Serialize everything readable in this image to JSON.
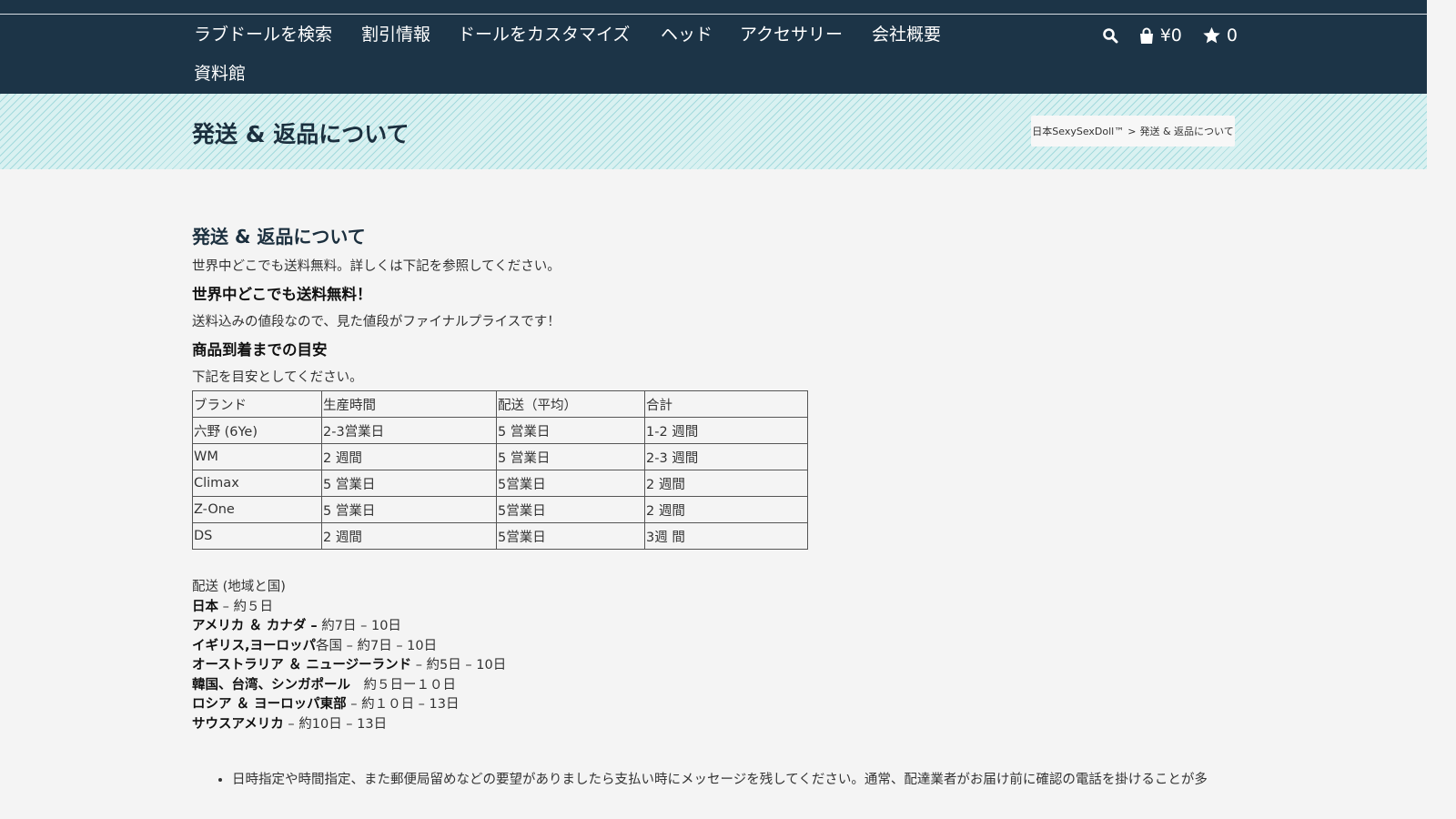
{
  "nav": {
    "items": [
      "ラブドールを検索",
      "割引情報",
      "ドールをカスタマイズ",
      "ヘッド",
      "アクセサリー",
      "会社概要",
      "資料館"
    ],
    "cart_amount": "¥0",
    "wishlist_count": "0",
    "icons": [
      "search-icon",
      "bag-icon",
      "star-icon"
    ]
  },
  "banner": {
    "title": "発送 & 返品について",
    "breadcrumb_home": "日本SexySexDoll™",
    "breadcrumb_sep": ">",
    "breadcrumb_current": "発送 & 返品について"
  },
  "content": {
    "heading": "発送 & 返品について",
    "intro": "世界中どこでも送料無料。詳しくは下記を参照してください。",
    "free_shipping_heading": "世界中どこでも送料無料！",
    "free_shipping_text": "送料込みの値段なので、見た値段がファイナルプライスです！",
    "arrival_heading": "商品到着までの目安",
    "arrival_text": "下記を目安としてください。",
    "table": {
      "headers": [
        "ブランド",
        "生産時間",
        "配送（平均）",
        "合計"
      ],
      "rows": [
        [
          "六野 (6Ye)",
          "2-3営業日",
          "5 営業日",
          "1-2 週間"
        ],
        [
          "WM",
          "2 週間",
          "5 営業日",
          "2-3 週間"
        ],
        [
          "Climax",
          "5 営業日",
          "5営業日",
          "2 週間"
        ],
        [
          "Z-One",
          "5 営業日",
          "5営業日",
          "2 週間"
        ],
        [
          "DS",
          "2 週間",
          "5営業日",
          "3週 間"
        ]
      ]
    },
    "regions_heading": "配送 (地域と国)",
    "regions": [
      {
        "name": "日本",
        "time": " – 約５日"
      },
      {
        "name": "アメリカ ＆ カナダ –",
        "time": " 約7日 – 10日"
      },
      {
        "name": "イギリス,ヨーロッパ",
        "time": "各国 – 約7日 – 10日"
      },
      {
        "name": "オーストラリア ＆ ニュージーランド",
        "time": " – 約5日 – 10日"
      },
      {
        "name": "韓国、台湾、シンガポール",
        "time": "　約５日ー１０日"
      },
      {
        "name": "ロシア ＆ ヨーロッパ東部",
        "time": " – 約１０日 – 13日"
      },
      {
        "name": "サウスアメリカ",
        "time": " – 約10日 – 13日"
      }
    ],
    "notes": [
      "日時指定や時間指定、また郵便局留めなどの要望がありましたら支払い時にメッセージを残してください。通常、配達業者がお届け前に確認の電話を掛けることが多"
    ]
  }
}
